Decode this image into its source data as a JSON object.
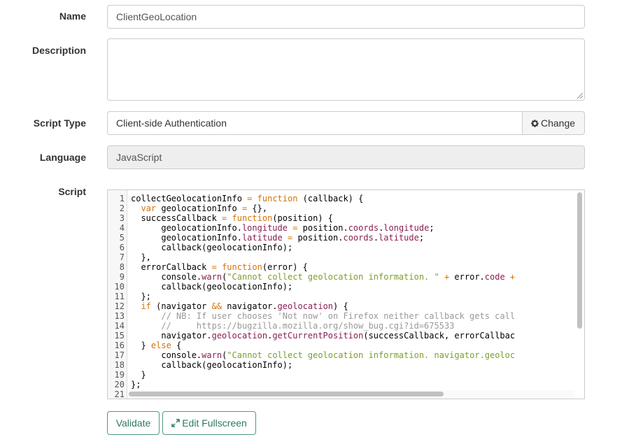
{
  "form": {
    "name": {
      "label": "Name",
      "value": "ClientGeoLocation"
    },
    "description": {
      "label": "Description",
      "value": ""
    },
    "script_type": {
      "label": "Script Type",
      "value": "Client-side Authentication",
      "change_button": "Change",
      "change_icon": "gear-icon"
    },
    "language": {
      "label": "Language",
      "value": "JavaScript"
    },
    "script": {
      "label": "Script"
    }
  },
  "buttons": {
    "validate": "Validate",
    "edit_fullscreen": "Edit Fullscreen",
    "edit_fullscreen_icon": "expand-icon"
  },
  "colors": {
    "keyword": "#d5730a",
    "property": "#8a1d55",
    "string": "#7ba02a",
    "comment": "#999999",
    "button_accent": "#2d7a5b"
  },
  "editor": {
    "line_numbers": [
      "1",
      "2",
      "3",
      "4",
      "5",
      "6",
      "7",
      "8",
      "9",
      "10",
      "11",
      "12",
      "13",
      "14",
      "15",
      "16",
      "17",
      "18",
      "19",
      "20",
      "21"
    ],
    "lines": [
      [
        [
          "t",
          "collectGeolocationInfo "
        ],
        [
          "k",
          "="
        ],
        [
          "t",
          " "
        ],
        [
          "k",
          "function"
        ],
        [
          "t",
          " (callback) {"
        ]
      ],
      [
        [
          "t",
          "  "
        ],
        [
          "k",
          "var"
        ],
        [
          "t",
          " geolocationInfo "
        ],
        [
          "k",
          "="
        ],
        [
          "t",
          " {},"
        ]
      ],
      [
        [
          "t",
          "  successCallback "
        ],
        [
          "k",
          "="
        ],
        [
          "t",
          " "
        ],
        [
          "k",
          "function"
        ],
        [
          "t",
          "(position) {"
        ]
      ],
      [
        [
          "t",
          "      geolocationInfo."
        ],
        [
          "p",
          "longitude"
        ],
        [
          "t",
          " "
        ],
        [
          "k",
          "="
        ],
        [
          "t",
          " position."
        ],
        [
          "p",
          "coords"
        ],
        [
          "t",
          "."
        ],
        [
          "p",
          "longitude"
        ],
        [
          "t",
          ";"
        ]
      ],
      [
        [
          "t",
          "      geolocationInfo."
        ],
        [
          "p",
          "latitude"
        ],
        [
          "t",
          " "
        ],
        [
          "k",
          "="
        ],
        [
          "t",
          " position."
        ],
        [
          "p",
          "coords"
        ],
        [
          "t",
          "."
        ],
        [
          "p",
          "latitude"
        ],
        [
          "t",
          ";"
        ]
      ],
      [
        [
          "t",
          "      callback(geolocationInfo);"
        ]
      ],
      [
        [
          "t",
          "  },"
        ]
      ],
      [
        [
          "t",
          "  errorCallback "
        ],
        [
          "k",
          "="
        ],
        [
          "t",
          " "
        ],
        [
          "k",
          "function"
        ],
        [
          "t",
          "(error) {"
        ]
      ],
      [
        [
          "t",
          "      console."
        ],
        [
          "p",
          "warn"
        ],
        [
          "t",
          "("
        ],
        [
          "s",
          "\"Cannot collect geolocation information. \""
        ],
        [
          "t",
          " "
        ],
        [
          "k",
          "+"
        ],
        [
          "t",
          " error."
        ],
        [
          "p",
          "code"
        ],
        [
          "t",
          " "
        ],
        [
          "k",
          "+"
        ]
      ],
      [
        [
          "t",
          "      callback(geolocationInfo);"
        ]
      ],
      [
        [
          "t",
          "  };"
        ]
      ],
      [
        [
          "t",
          "  "
        ],
        [
          "k",
          "if"
        ],
        [
          "t",
          " (navigator "
        ],
        [
          "k",
          "&&"
        ],
        [
          "t",
          " navigator."
        ],
        [
          "p",
          "geolocation"
        ],
        [
          "t",
          ") {"
        ]
      ],
      [
        [
          "t",
          "      "
        ],
        [
          "c",
          "// NB: If user chooses 'Not now' on Firefox neither callback gets call"
        ]
      ],
      [
        [
          "t",
          "      "
        ],
        [
          "c",
          "//     https://bugzilla.mozilla.org/show_bug.cgi?id=675533"
        ]
      ],
      [
        [
          "t",
          "      navigator."
        ],
        [
          "p",
          "geolocation"
        ],
        [
          "t",
          "."
        ],
        [
          "p",
          "getCurrentPosition"
        ],
        [
          "t",
          "(successCallback, errorCallbac"
        ]
      ],
      [
        [
          "t",
          "  } "
        ],
        [
          "k",
          "else"
        ],
        [
          "t",
          " {"
        ]
      ],
      [
        [
          "t",
          "      console."
        ],
        [
          "p",
          "warn"
        ],
        [
          "t",
          "("
        ],
        [
          "s",
          "\"Cannot collect geolocation information. navigator.geoloc"
        ]
      ],
      [
        [
          "t",
          "      callback(geolocationInfo);"
        ]
      ],
      [
        [
          "t",
          "  }"
        ]
      ],
      [
        [
          "t",
          "};"
        ]
      ],
      [
        [
          "t",
          ""
        ]
      ]
    ]
  }
}
